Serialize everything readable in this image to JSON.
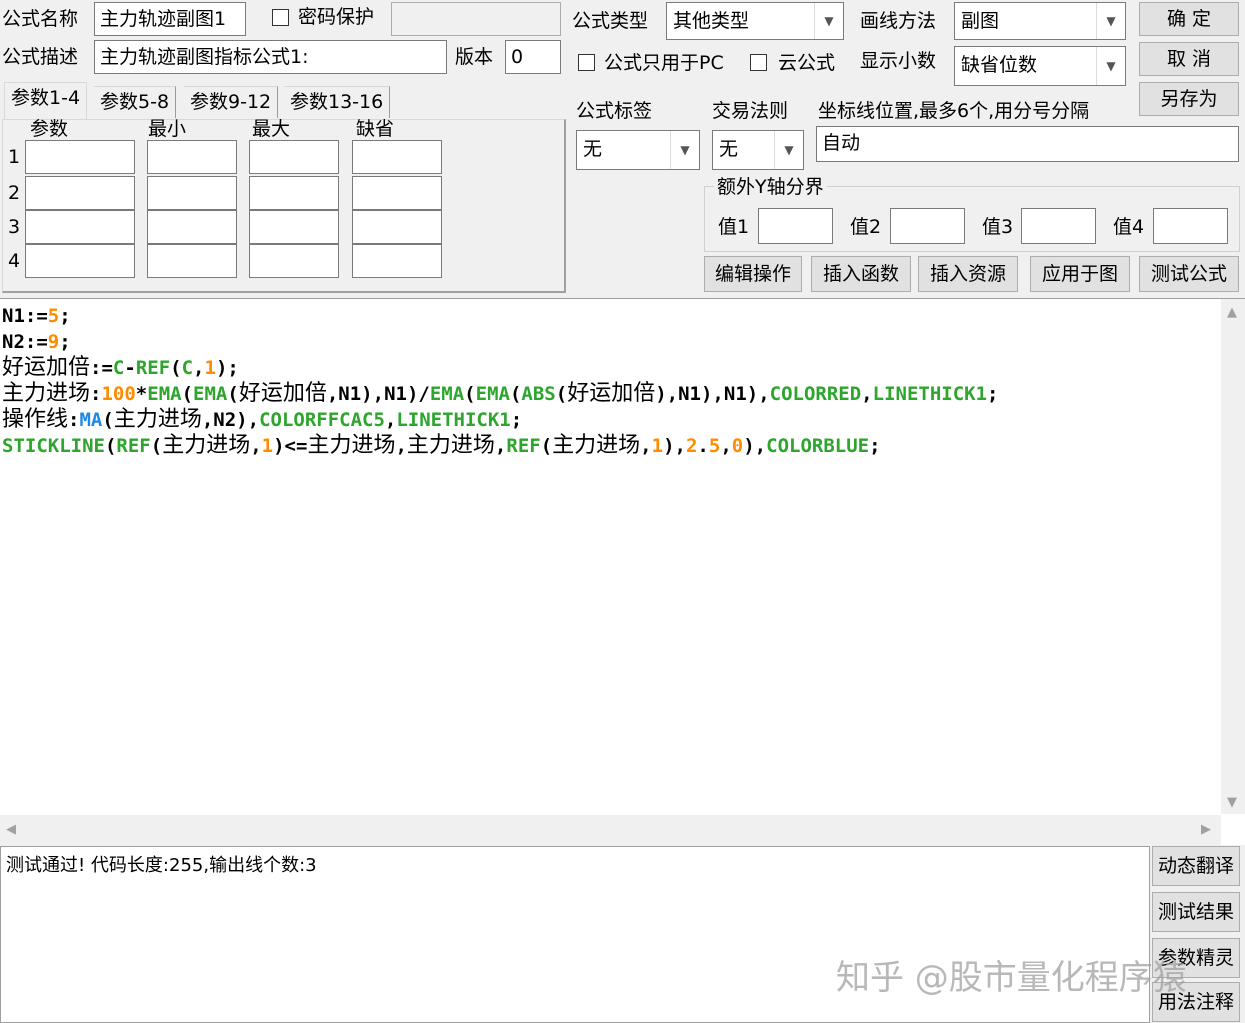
{
  "form": {
    "name_label": "公式名称",
    "name_value": "主力轨迹副图1",
    "password_label": "密码保护",
    "desc_label": "公式描述",
    "desc_value": "主力轨迹副图指标公式1:",
    "version_label": "版本",
    "version_value": "0",
    "type_label": "公式类型",
    "type_value": "其他类型",
    "draw_label": "画线方法",
    "draw_value": "副图",
    "pc_only_label": "公式只用于PC",
    "cloud_label": "云公式",
    "decimal_label": "显示小数",
    "decimal_value": "缺省位数",
    "tag_label": "公式标签",
    "tag_value": "无",
    "trade_label": "交易法则",
    "trade_value": "无",
    "coord_label": "坐标线位置,最多6个,用分号分隔",
    "coord_value": "自动",
    "yaxis_group": "额外Y轴分界",
    "v1": "值1",
    "v2": "值2",
    "v3": "值3",
    "v4": "值4"
  },
  "buttons": {
    "ok": "确 定",
    "cancel": "取 消",
    "save_as": "另存为",
    "edit_ops": "编辑操作",
    "insert_func": "插入函数",
    "insert_res": "插入资源",
    "apply_chart": "应用于图",
    "test_formula": "测试公式"
  },
  "tabs": [
    "参数1-4",
    "参数5-8",
    "参数9-12",
    "参数13-16"
  ],
  "params": {
    "headers": [
      "参数",
      "最小",
      "最大",
      "缺省"
    ],
    "rows": [
      "1",
      "2",
      "3",
      "4"
    ]
  },
  "code_lines": [
    "N1:=5;",
    "N2:=9;",
    "好运加倍:=C-REF(C,1);",
    "主力进场:100*EMA(EMA(好运加倍,N1),N1)/EMA(EMA(ABS(好运加倍),N1),N1),COLORRED,LINETHICK1;",
    "操作线:MA(主力进场,N2),COLORFFCAC5,LINETHICK1;",
    "STICKLINE(REF(主力进场,1)<=主力进场,主力进场,REF(主力进场,1),2.5,0),COLORBLUE;"
  ],
  "result_text": "测试通过! 代码长度:255,输出线个数:3",
  "side_buttons": [
    "动态翻译",
    "测试结果",
    "参数精灵",
    "用法注释"
  ],
  "watermark": "知乎 @股市量化程序猿",
  "colors": {
    "number": "#ff8c00",
    "function": "#2ea62e",
    "ma": "#1e88e5"
  }
}
